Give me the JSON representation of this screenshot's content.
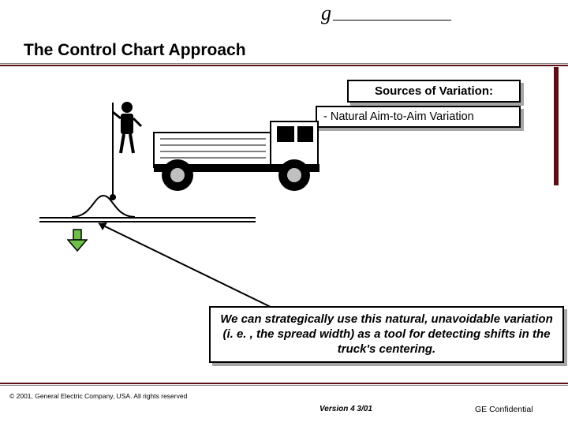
{
  "logo": {
    "letter": "g"
  },
  "title": "The Control Chart Approach",
  "sources_box": "Sources of Variation:",
  "natural_box": "- Natural Aim-to-Aim Variation",
  "bottom_box": "We can strategically use this natural, unavoidable variation (i. e. , the spread width) as a tool for detecting shifts in the truck's centering.",
  "footer": {
    "copyright": "© 2001, General Electric Company, USA. All rights reserved",
    "version": "Version 4  3/01",
    "confidential": "GE Confidential"
  }
}
